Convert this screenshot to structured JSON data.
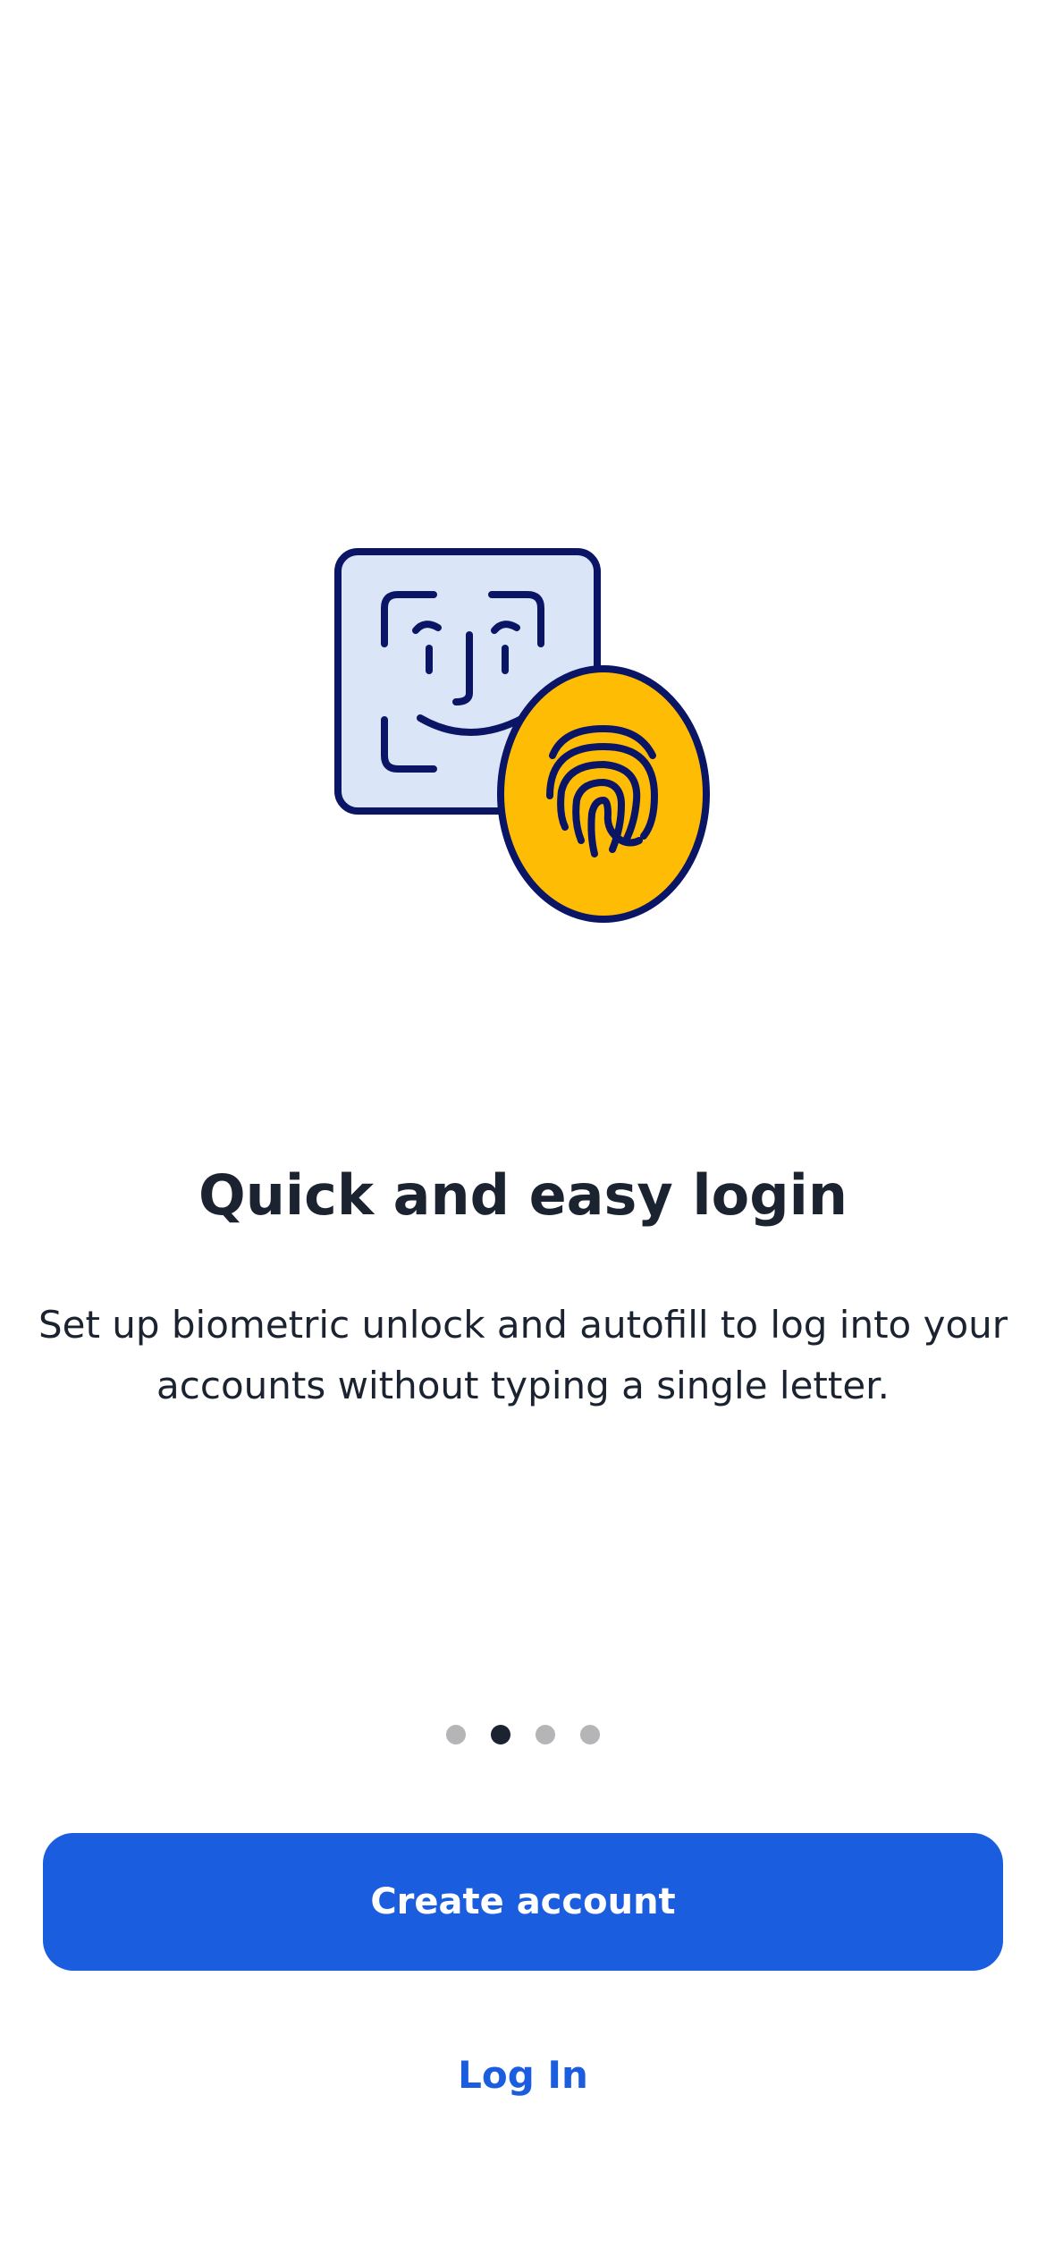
{
  "onboarding": {
    "title": "Quick and easy login",
    "description": "Set up biometric unlock and autofill to log into your accounts without typing a single letter.",
    "page_indicator": {
      "total": 4,
      "current": 2
    }
  },
  "actions": {
    "create_account_label": "Create account",
    "log_in_label": "Log In"
  },
  "illustration": {
    "icons": [
      "face-id-icon",
      "fingerprint-icon"
    ]
  },
  "colors": {
    "primary": "#1a5ddf",
    "text": "#1b2331",
    "face_tile": "#dbe5f8",
    "fingerprint_badge": "#ffbc05",
    "outline": "#0a1566",
    "dot_inactive": "#b5b5b7"
  }
}
